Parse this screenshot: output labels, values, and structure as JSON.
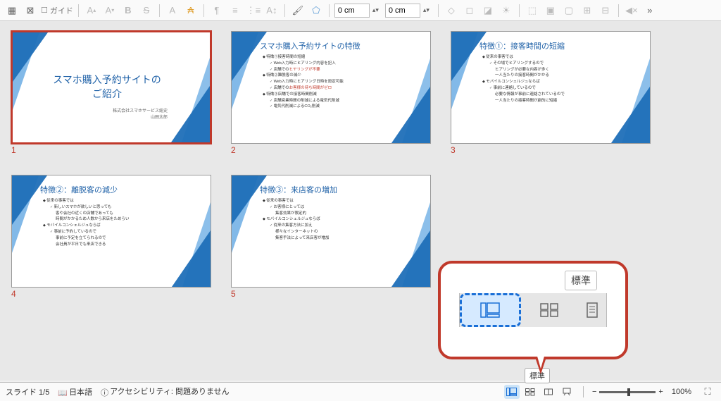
{
  "toolbar": {
    "guide_label": "ガイド",
    "measure1": "0 cm",
    "measure2": "0 cm"
  },
  "slides": [
    {
      "num": "1",
      "layout": "title",
      "title": "スマホ購入予約サイトの\nご紹介",
      "subtitle": "株式会社スマホサービス総史\n山田太郎",
      "selected": true
    },
    {
      "num": "2",
      "layout": "content",
      "title": "スマホ購入予約サイトの特徴",
      "bullets": [
        {
          "text": "特徴①接客時間の短縮",
          "lvl": 0
        },
        {
          "text": "Web入力時にヒアリング内容を記入",
          "lvl": 1
        },
        {
          "text": "店舗でのヒヤリングが不要",
          "lvl": 1,
          "accent": true
        },
        {
          "text": "特徴②難脱客の減少",
          "lvl": 0
        },
        {
          "text": "Web入力時にヒアリング日時を設定可能",
          "lvl": 1
        },
        {
          "text": "店舗でのお客様の待ち時間がゼロ",
          "lvl": 1,
          "accent": true
        },
        {
          "text": "特徴③店舗での接客時間削減",
          "lvl": 0
        },
        {
          "text": "店舗営業時間の削減による電気代削減",
          "lvl": 1
        },
        {
          "text": "電気代削減によるCO₂削減",
          "lvl": 1
        }
      ]
    },
    {
      "num": "3",
      "layout": "content",
      "title": "特徴①：接客時間の短縮",
      "bullets": [
        {
          "text": "従来の事客では",
          "lvl": 0
        },
        {
          "text": "その場でヒアリングするので",
          "lvl": 1
        },
        {
          "text": "ヒアリングが必要な内容が多く",
          "lvl": 2
        },
        {
          "text": "一人当たりの接客時間がかかる",
          "lvl": 2
        },
        {
          "text": "モバイルコンシェルジュならば",
          "lvl": 0
        },
        {
          "text": "事前に連絡しているので",
          "lvl": 1
        },
        {
          "text": "必要な情報が事前に連絡されているので",
          "lvl": 2
        },
        {
          "text": "一人当たりの接客時間が劇的に短縮",
          "lvl": 2
        }
      ]
    },
    {
      "num": "4",
      "layout": "content",
      "title": "特徴②：離脱客の減少",
      "bullets": [
        {
          "text": "従来の事客では",
          "lvl": 0
        },
        {
          "text": "新しいスマホが欲しいと思っても",
          "lvl": 1
        },
        {
          "text": "客や会社の近くの店舗であっても",
          "lvl": 2
        },
        {
          "text": "時間がかかるため人数から来店をためらい",
          "lvl": 2
        },
        {
          "text": "モバイルコンシェルジュならば",
          "lvl": 0
        },
        {
          "text": "事前に予約しているので",
          "lvl": 1
        },
        {
          "text": "事前に予定を立てられるので",
          "lvl": 2
        },
        {
          "text": "会社員が平日でも来店できる",
          "lvl": 2
        }
      ]
    },
    {
      "num": "5",
      "layout": "content",
      "title": "特徴③：来店客の増加",
      "bullets": [
        {
          "text": "従来の事客では",
          "lvl": 0
        },
        {
          "text": "お客様にとっては",
          "lvl": 1
        },
        {
          "text": "集客効果が限定的",
          "lvl": 2
        },
        {
          "text": "モバイルコンシェルジュならば",
          "lvl": 0
        },
        {
          "text": "従来の集客方法に加え",
          "lvl": 1
        },
        {
          "text": "様々なインターネットの",
          "lvl": 2
        },
        {
          "text": "集客手法によって来店客が増加",
          "lvl": 2
        }
      ]
    }
  ],
  "callout": {
    "tooltip": "標準"
  },
  "statusbar": {
    "slide_counter": "スライド 1/5",
    "language": "日本語",
    "accessibility": "アクセシビリティ: 問題ありません",
    "tooltip": "標準",
    "zoom": "100%"
  }
}
